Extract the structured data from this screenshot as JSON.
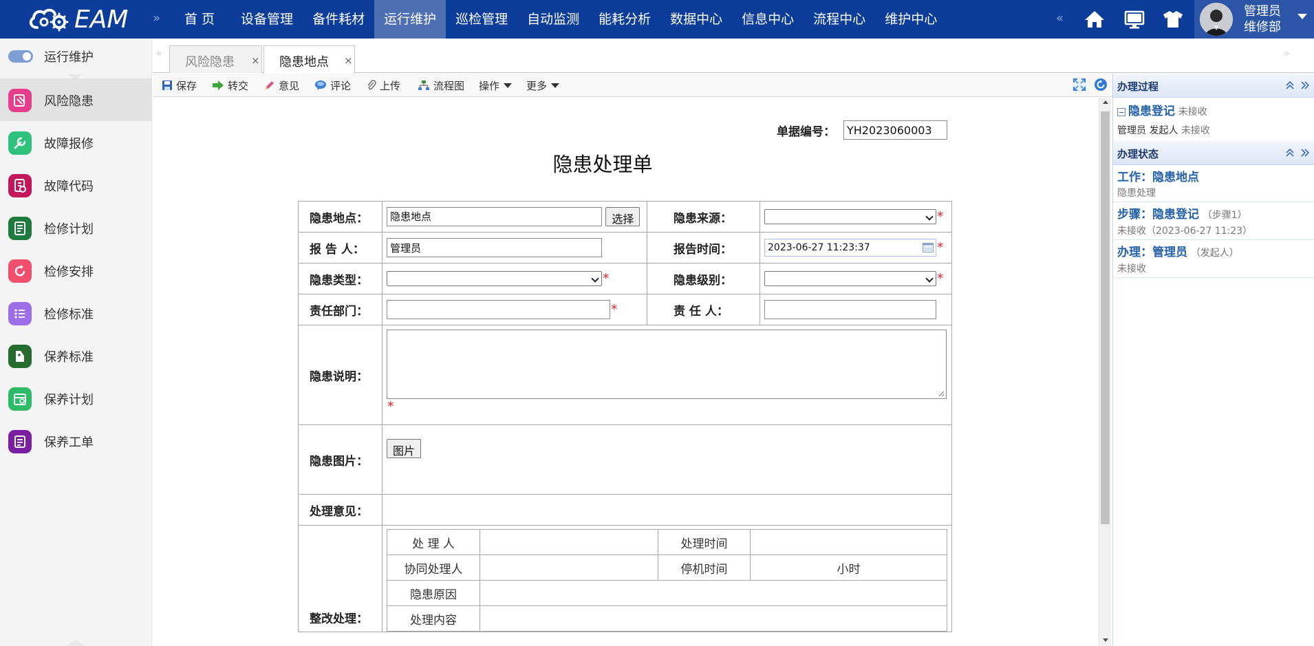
{
  "app": {
    "logo_text": "EAM"
  },
  "nav": {
    "items": [
      "首 页",
      "设备管理",
      "备件耗材",
      "运行维护",
      "巡检管理",
      "自动监测",
      "能耗分析",
      "数据中心",
      "信息中心",
      "流程中心",
      "维护中心"
    ],
    "active": "运行维护",
    "chevron_left": "»",
    "chevron_right": "«"
  },
  "user": {
    "name": "管理员",
    "dept": "维修部"
  },
  "sidebar": {
    "header": "运行维护",
    "items": [
      {
        "label": "风险隐患",
        "color": "#e53e8c",
        "icon": "risk-icon"
      },
      {
        "label": "故障报修",
        "color": "#2ec27e",
        "icon": "wrench-icon"
      },
      {
        "label": "故障代码",
        "color": "#c2185b",
        "icon": "code-icon"
      },
      {
        "label": "检修计划",
        "color": "#1e7a3e",
        "icon": "plan-icon"
      },
      {
        "label": "检修安排",
        "color": "#f0506e",
        "icon": "refresh-icon"
      },
      {
        "label": "检修标准",
        "color": "#9c6ee8",
        "icon": "list-icon"
      },
      {
        "label": "保养标准",
        "color": "#276c2f",
        "icon": "tag-icon"
      },
      {
        "label": "保养计划",
        "color": "#2dbb6a",
        "icon": "calendar-icon"
      },
      {
        "label": "保养工单",
        "color": "#7b1fa2",
        "icon": "order-icon"
      }
    ],
    "active_index": 0
  },
  "tabs": [
    {
      "label": "风险隐患",
      "close": "×"
    },
    {
      "label": "隐患地点",
      "close": "×"
    }
  ],
  "toolbar": {
    "save": "保存",
    "transfer": "转交",
    "opinion": "意见",
    "comment": "评论",
    "upload": "上传",
    "flowchart": "流程图",
    "operate": "操作",
    "more": "更多"
  },
  "form": {
    "doc_no_label": "单据编号：",
    "doc_no_value": "YH2023060003",
    "title": "隐患处理单",
    "location_label": "隐患地点：",
    "location_value": "隐患地点",
    "select_button": "选择",
    "source_label": "隐患来源：",
    "reporter_label": "报 告 人：",
    "reporter_value": "管理员",
    "report_time_label": "报告时间：",
    "report_time_value": "2023-06-27 11:23:37",
    "type_label": "隐患类型：",
    "level_label": "隐患级别：",
    "dept_label": "责任部门：",
    "owner_label": "责 任 人：",
    "desc_label": "隐患说明：",
    "pic_label": "隐患图片：",
    "pic_button": "图片",
    "opinion_label": "处理意见：",
    "rectify_label": "整改处理：",
    "required_mark": "*",
    "inner": {
      "handler": "处 理 人",
      "handle_time": "处理时间",
      "co_handler": "协同处理人",
      "downtime": "停机时间",
      "hours": "小时",
      "cause": "隐患原因",
      "content": "处理内容"
    }
  },
  "right_panel": {
    "process_title": "办理过程",
    "process_step": "隐患登记",
    "process_step_status": "未接收",
    "process_user": "管理员",
    "process_role": "发起人",
    "process_user_status": "未接收",
    "status_title": "办理状态",
    "work_label": "工作：",
    "work_value": "隐患地点",
    "work_sub": "隐患处理",
    "step_label": "步骤：",
    "step_value": "隐患登记",
    "step_note": "（步骤1）",
    "step_sub": "未接收（2023-06-27 11:23）",
    "handle_label": "办理：",
    "handle_value": "管理员",
    "handle_note": "（发起人）",
    "handle_sub": "未接收"
  }
}
